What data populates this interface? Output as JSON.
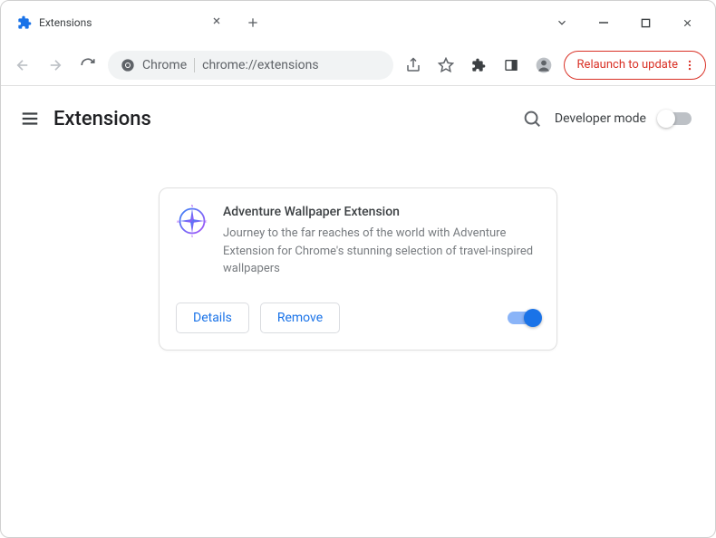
{
  "window": {
    "tab_title": "Extensions"
  },
  "toolbar": {
    "omnibox_label": "Chrome",
    "omnibox_url": "chrome://extensions",
    "relaunch_label": "Relaunch to update"
  },
  "page": {
    "title": "Extensions",
    "developer_mode_label": "Developer mode",
    "developer_mode_on": false
  },
  "extension": {
    "name": "Adventure Wallpaper Extension",
    "description": "Journey to the far reaches of the world with Adventure Extension for Chrome's stunning selection of travel-inspired wallpapers",
    "details_label": "Details",
    "remove_label": "Remove",
    "enabled": true
  }
}
